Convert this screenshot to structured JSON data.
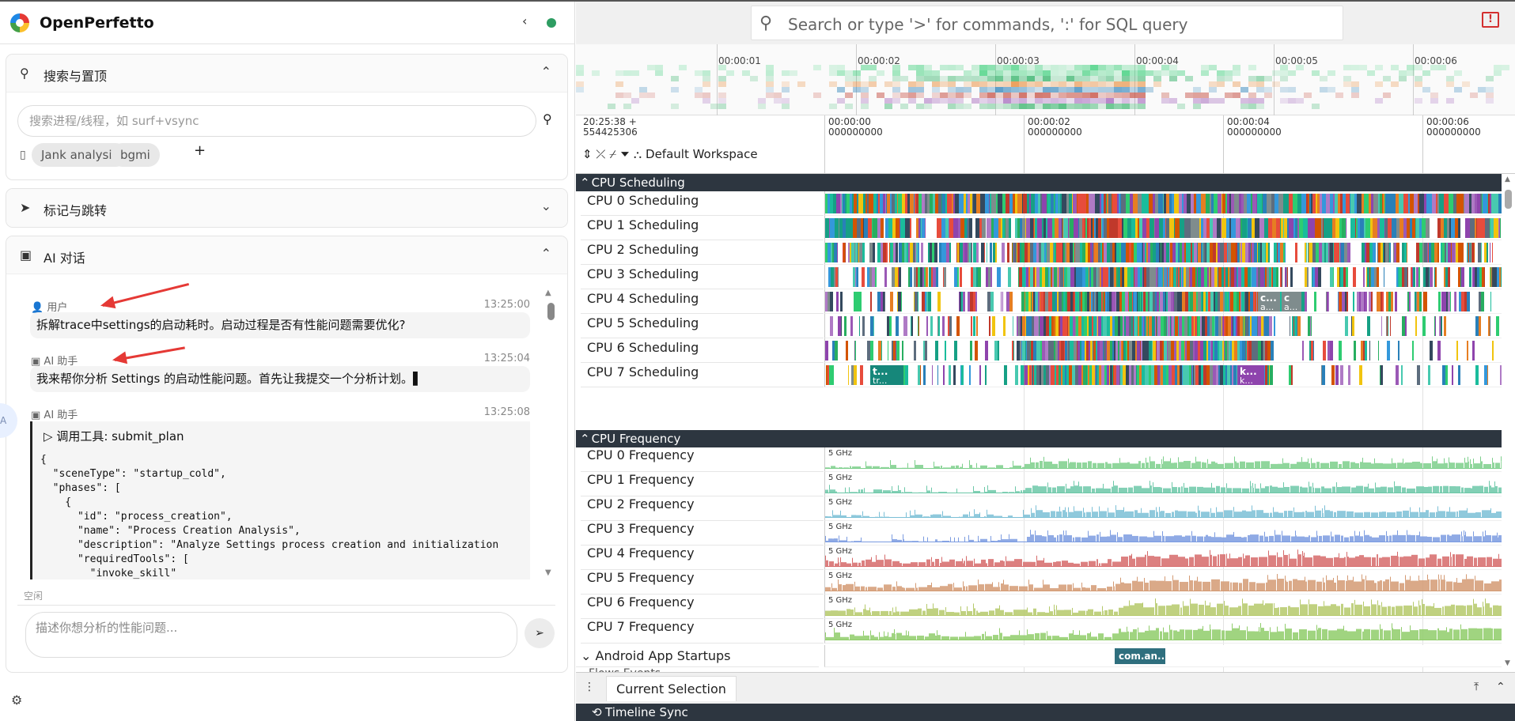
{
  "app": {
    "name": "OpenPerfetto",
    "collapse_icon": "chevron-left-icon",
    "status_color": "#2e9d62"
  },
  "search_section": {
    "title": "搜索与置顶",
    "input_placeholder": "搜索进程/线程，如 surf+vsync",
    "chips": [
      "Jank analysis",
      "bgmi"
    ],
    "add_label": "+"
  },
  "marks_section": {
    "title": "标记与跳转"
  },
  "ai_section": {
    "title": "AI 对话",
    "messages": [
      {
        "role": "用户",
        "time": "13:25:00",
        "text": "拆解trace中settings的启动耗时。启动过程是否有性能问题需要优化?"
      },
      {
        "role": "AI 助手",
        "time": "13:25:04",
        "text": "我来帮你分析 Settings 的启动性能问题。首先让我提交一个分析计划。▌"
      },
      {
        "role": "AI 助手",
        "time": "13:25:08",
        "tool_title": "调用工具: submit_plan",
        "code": "{\n  \"sceneType\": \"startup_cold\",\n  \"phases\": [\n    {\n      \"id\": \"process_creation\",\n      \"name\": \"Process Creation Analysis\",\n      \"description\": \"Analyze Settings process creation and initialization\n      \"requiredTools\": [\n        \"invoke_skill\"\n      ]"
      }
    ],
    "status": "空闲",
    "input_placeholder": "描述你想分析的性能问题..."
  },
  "omnibox": {
    "placeholder": "Search or type '>' for commands, ':' for SQL query"
  },
  "overview": {
    "ticks": [
      "00:00:01",
      "00:00:02",
      "00:00:03",
      "00:00:04",
      "00:00:05",
      "00:00:06"
    ]
  },
  "time_axis": {
    "origin_line1": "20:25:38  +",
    "origin_line2": "554425306",
    "ticks": [
      {
        "l1": "00:00:00",
        "l2": "000000000"
      },
      {
        "l1": "00:00:02",
        "l2": "000000000"
      },
      {
        "l1": "00:00:04",
        "l2": "000000000"
      },
      {
        "l1": "00:00:06",
        "l2": "000000000"
      }
    ],
    "workspace": "Default Workspace"
  },
  "groups": {
    "cpu_sched": "CPU Scheduling",
    "cpu_freq": "CPU Frequency",
    "android_startups": "Android App Startups",
    "partial": "Flows Events"
  },
  "sched_tracks": [
    "CPU 0 Scheduling",
    "CPU 1 Scheduling",
    "CPU 2 Scheduling",
    "CPU 3 Scheduling",
    "CPU 4 Scheduling",
    "CPU 5 Scheduling",
    "CPU 6 Scheduling",
    "CPU 7 Scheduling"
  ],
  "freq_tracks": [
    "CPU 0 Frequency",
    "CPU 1 Frequency",
    "CPU 2 Frequency",
    "CPU 3 Frequency",
    "CPU 4 Frequency",
    "CPU 5 Frequency",
    "CPU 6 Frequency",
    "CPU 7 Frequency"
  ],
  "freq_max_label": "5 GHz",
  "freq_colors": [
    "#7ccf8b",
    "#6cc8a8",
    "#7bbfd6",
    "#7b9be0",
    "#d66a6a",
    "#d49a73",
    "#b5c96a",
    "#8fcc6a"
  ],
  "slice_labels": {
    "cpu4": [
      "c...",
      "c",
      "a...",
      "a..."
    ],
    "cpu7": [
      "t...",
      "tr...",
      "k...",
      "k..."
    ],
    "startup": "com.an..."
  },
  "bottom": {
    "tab": "Current Selection",
    "timeline_sync": "Timeline Sync"
  }
}
